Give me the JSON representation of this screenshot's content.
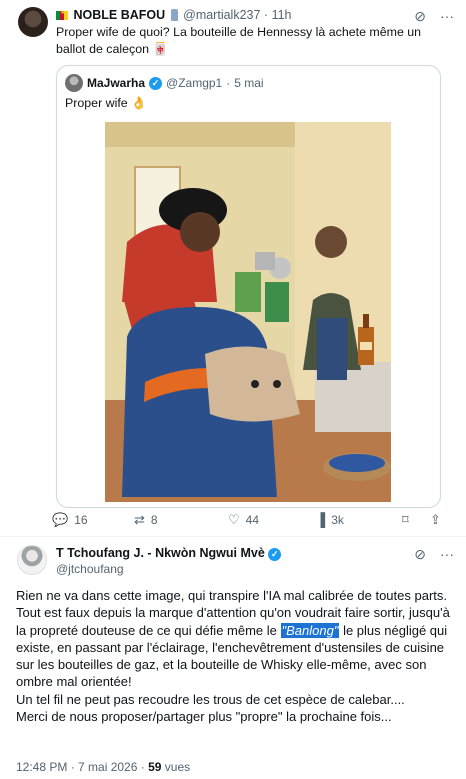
{
  "tweet1": {
    "name": "NOBLE BAFOU",
    "handle": "@martialk237",
    "dot": "·",
    "time": "11h",
    "text": "Proper wife de quoi? La bouteille de Hennessy là achete même un ballot de caleçon 🀄",
    "quote": {
      "name": "MaJwarha",
      "handle": "@Zamgp1",
      "dot": "·",
      "time": "5 mai",
      "text": "Proper wife 👌"
    },
    "stats": {
      "replies": "16",
      "retweets": "8",
      "likes": "44",
      "views": "3k"
    }
  },
  "tweet2": {
    "name": "T Tchoufang J. - Nkwòn Ngwui Mvè",
    "handle": "@jtchoufang",
    "para1": "Rien ne va dans cette image, qui transpire l'IA mal calibrée de toutes parts.",
    "para2_a": "Tout est faux depuis la marque d'attention qu'on voudrait faire sortir, jusqu'à la propreté douteuse de ce qui défie même le ",
    "para2_hl": "\"Banlong\"",
    "para2_b": " le plus négligé qui existe, en passant par l'éclairage, l'enchevêtrement d'ustensiles de cuisine sur les bouteilles de gaz, et la bouteille de Whisky elle-même, avec son ombre  mal orientée!",
    "para3": "Un tel fil ne peut pas recoudre les trous de cet espèce de calebar....",
    "para4": "Merci de nous proposer/partager plus \"propre\" la prochaine fois...",
    "time": "12:48 PM · 7 mai 2026 · ",
    "views_count": "59",
    "views_label": " vues"
  },
  "colors": {
    "accent": "#1d9bf0",
    "muted": "#536471",
    "highlight": "#1d73d4"
  }
}
